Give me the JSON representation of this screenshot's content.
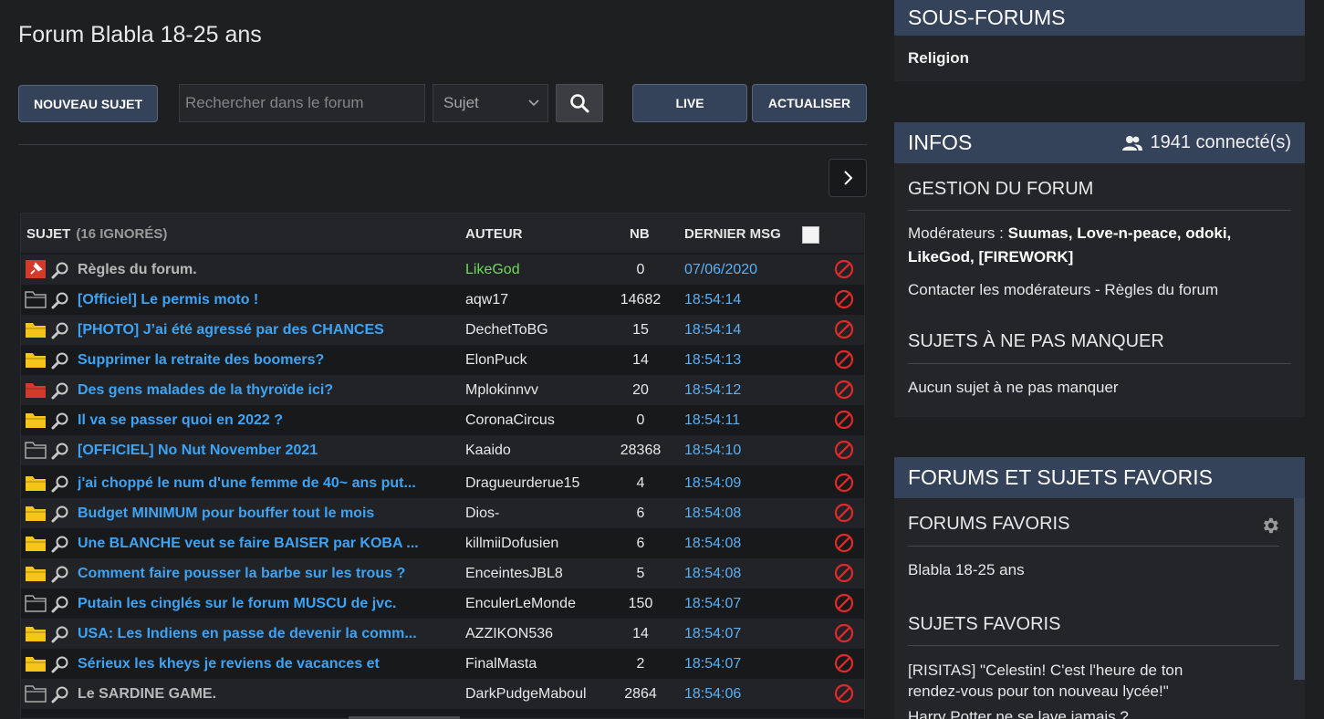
{
  "page": {
    "title": "Forum Blabla 18-25 ans"
  },
  "toolbar": {
    "new_topic": "NOUVEAU SUJET",
    "search_placeholder": "Rechercher dans le forum",
    "search_scope": "Sujet",
    "live": "LIVE",
    "refresh": "ACTUALISER"
  },
  "table": {
    "col_subject": "SUJET",
    "ignored": "(16 IGNORÉS)",
    "col_author": "AUTEUR",
    "col_nb": "NB",
    "col_last": "DERNIER MSG"
  },
  "topics": [
    {
      "icon": "pinned",
      "subject": "Règles du forum.",
      "author": "LikeGod",
      "nb": "0",
      "last": "07/06/2020"
    },
    {
      "icon": "folder-empty",
      "subject": "[Officiel] Le permis moto !",
      "author": "aqw17",
      "nb": "14682",
      "last": "18:54:14"
    },
    {
      "icon": "folder-yellow",
      "subject": "[PHOTO] J’ai été agressé par des CHANCES",
      "author": "DechetToBG",
      "nb": "15",
      "last": "18:54:14"
    },
    {
      "icon": "folder-yellow",
      "subject": "Supprimer la retraite des boomers?",
      "author": "ElonPuck",
      "nb": "14",
      "last": "18:54:13"
    },
    {
      "icon": "folder-red",
      "subject": "Des gens malades de la thyroïde ici?",
      "author": "Mplokinnvv",
      "nb": "20",
      "last": "18:54:12"
    },
    {
      "icon": "folder-yellow",
      "subject": "Il va se passer quoi en 2022 ?",
      "author": "CoronaCircus",
      "nb": "0",
      "last": "18:54:11"
    },
    {
      "icon": "folder-empty",
      "subject": "[OFFICIEL] No Nut November 2021",
      "author": "Kaaido",
      "nb": "28368",
      "last": "18:54:10"
    },
    {
      "icon": "folder-yellow",
      "subject": "j'ai choppé le num d'une femme de 40~ ans put...",
      "author": "Dragueurderue15",
      "nb": "4",
      "last": "18:54:09"
    },
    {
      "icon": "folder-yellow",
      "subject": "Budget MINIMUM pour bouffer tout le mois",
      "author": "Dios-",
      "nb": "6",
      "last": "18:54:08"
    },
    {
      "icon": "folder-yellow",
      "subject": "Une BLANCHE veut se faire BAISER par KOBA ...",
      "author": "killmiiDofusien",
      "nb": "6",
      "last": "18:54:08"
    },
    {
      "icon": "folder-yellow",
      "subject": "Comment faire pousser la barbe sur les trous ?",
      "author": "EnceintesJBL8",
      "nb": "5",
      "last": "18:54:08"
    },
    {
      "icon": "folder-empty",
      "subject": "Putain les cinglés sur le forum MUSCU de jvc.",
      "author": "EnculerLeMonde",
      "nb": "150",
      "last": "18:54:07"
    },
    {
      "icon": "folder-yellow",
      "subject": "USA: Les Indiens en passe de devenir la comm...",
      "author": "AZZIKON536",
      "nb": "14",
      "last": "18:54:07"
    },
    {
      "icon": "folder-yellow",
      "subject": "Sérieux les kheys je reviens de vacances et",
      "author": "FinalMasta",
      "nb": "2",
      "last": "18:54:07"
    },
    {
      "icon": "folder-empty",
      "subject": "Le SARDINE GAME.",
      "author": "DarkPudgeMaboul",
      "nb": "2864",
      "last": "18:54:06"
    }
  ],
  "sidebar": {
    "subforums_title": "SOUS-FORUMS",
    "subforum_item": "Religion",
    "infos_title": "INFOS",
    "connected": "1941 connecté(s)",
    "management_title": "GESTION DU FORUM",
    "moderators_label": "Modérateurs : ",
    "moderators": "Suumas, Love-n-peace, odoki, LikeGod, [FIREWORK]",
    "contact_text": "Contacter les modérateurs - Règles du forum",
    "must_see_title": "SUJETS À NE PAS MANQUER",
    "must_see_text": "Aucun sujet à ne pas manquer",
    "favorites_title": "FORUMS ET SUJETS FAVORIS",
    "fav_forums_title": "FORUMS FAVORIS",
    "fav_forum_item": "Blabla 18-25 ans",
    "fav_topics_title": "SUJETS FAVORIS",
    "fav_topic_1": "[RISITAS] \"Celestin! C'est l'heure de ton rendez-vous pour ton nouveau lycée!\"",
    "fav_topic_2": "Harry Potter ne se lave jamais ?"
  },
  "colors": {
    "accent_header": "#34425a",
    "link_blue": "#3da3f5",
    "folder_yellow": "#f5c518",
    "folder_red": "#d33a2c",
    "ban_red": "#e02a2a",
    "author_green": "#6fd85d"
  }
}
